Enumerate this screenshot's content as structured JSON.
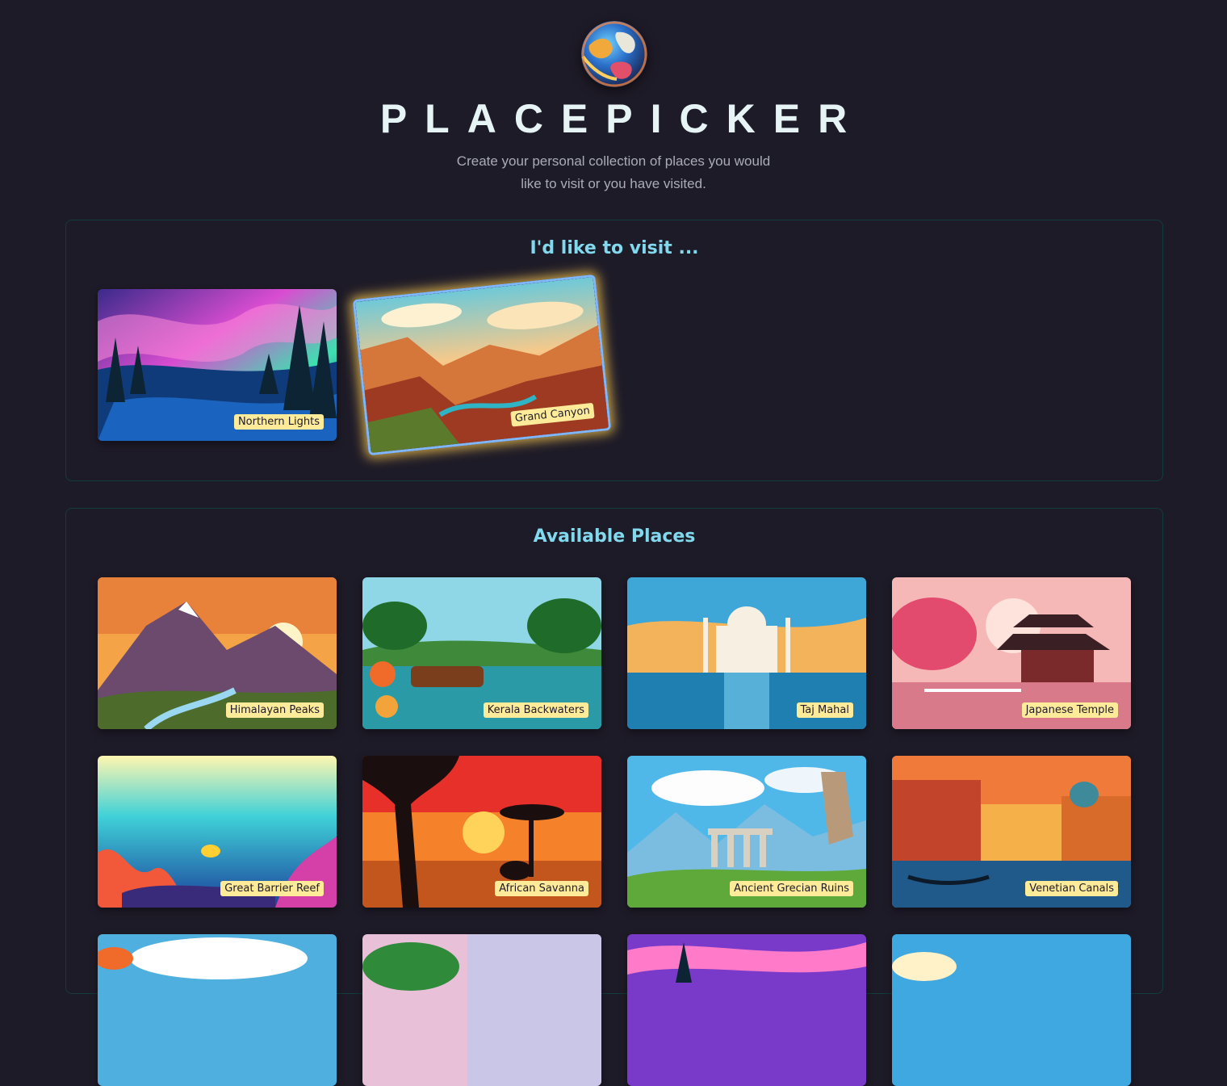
{
  "app": {
    "title": "PLACEPICKER",
    "subtitle": "Create your personal collection of places you would like to visit or you have visited."
  },
  "visit": {
    "heading": "I'd like to visit ...",
    "items": [
      "Northern Lights",
      "Grand Canyon"
    ]
  },
  "available": {
    "heading": "Available Places",
    "items": [
      "Himalayan Peaks",
      "Kerala Backwaters",
      "Taj Mahal",
      "Japanese Temple",
      "Great Barrier Reef",
      "African Savanna",
      "Ancient Grecian Ruins",
      "Venetian Canals"
    ]
  },
  "colors": {
    "background": "#1e1b28",
    "accent": "#82d9ee",
    "label_bg": "#fdeb9a",
    "border": "#123c3e"
  }
}
